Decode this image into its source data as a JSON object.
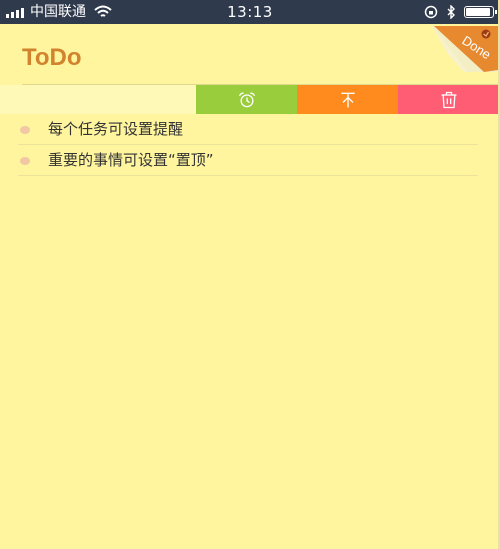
{
  "status_bar": {
    "carrier": "中国联通",
    "time": "13:13",
    "signal_icon": "signal-icon",
    "wifi_icon": "wifi-icon",
    "battery_icon": "battery-icon"
  },
  "header": {
    "title": "ToDo",
    "done_label": "Done"
  },
  "actions": {
    "reminder_icon": "alarm-clock-icon",
    "pin_top_icon": "pin-to-top-icon",
    "delete_icon": "trash-icon",
    "colors": {
      "reminder": "#9acd3c",
      "pin_top": "#ff8b1f",
      "delete": "#ff5d73"
    }
  },
  "tasks": [
    {
      "text": "每个任务可设置提醒"
    },
    {
      "text": "重要的事情可设置“置顶”"
    }
  ],
  "colors": {
    "background": "#fff59f",
    "title": "#d2832d",
    "status_bar": "#2f3a4d"
  }
}
